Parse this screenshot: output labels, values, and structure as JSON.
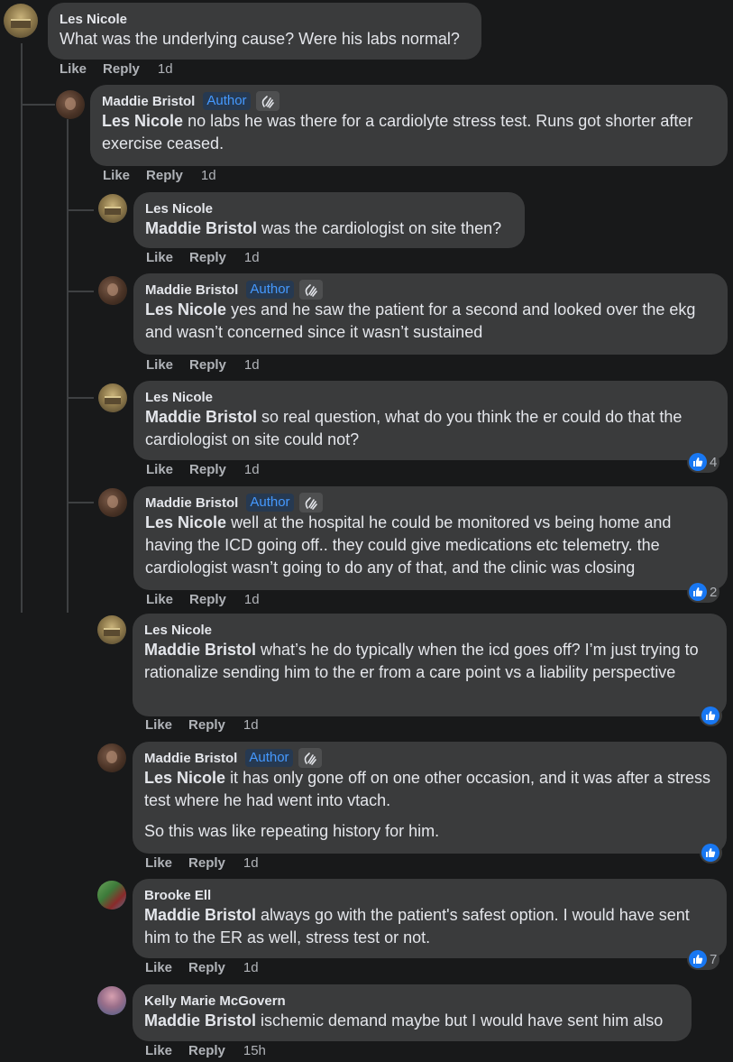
{
  "thread": {
    "labels": {
      "like": "Like",
      "reply": "Reply",
      "author_badge": "Author"
    },
    "comments": [
      {
        "name": "Les Nicole",
        "mention": "",
        "text": "What was the underlying cause? Were his labs normal?",
        "time": "1d"
      },
      {
        "name": "Maddie Bristol",
        "mention": "Les Nicole",
        "text": "no labs he was there for a cardiolyte stress test. Runs got shorter after exercise ceased.",
        "time": "1d"
      },
      {
        "name": "Les Nicole",
        "mention": "Maddie Bristol",
        "text": "was the cardiologist on site then?",
        "time": "1d"
      },
      {
        "name": "Maddie Bristol",
        "mention": "Les Nicole",
        "text": "yes and he saw the patient for a second and looked over the ekg and wasn’t concerned since it wasn’t sustained",
        "time": "1d"
      },
      {
        "name": "Les Nicole",
        "mention": "Maddie Bristol",
        "text": "so real question, what do you think the er could do that the cardiologist on site could not?",
        "time": "1d",
        "reactions": "4"
      },
      {
        "name": "Maddie Bristol",
        "mention": "Les Nicole",
        "text": "well at the hospital he could be monitored vs being home and having the ICD going off.. they could give medications etc telemetry. the cardiologist wasn’t going to do any of that, and the clinic was closing",
        "time": "1d",
        "reactions": "2"
      },
      {
        "name": "Les Nicole",
        "mention": "Maddie Bristol",
        "text": "what’s he do typically when the icd goes off? I’m just trying to rationalize sending him to the er from a care point vs a liability perspective",
        "time": "1d"
      },
      {
        "name": "Maddie Bristol",
        "mention": "Les Nicole",
        "text": "it has only gone off on one other occasion, and it was after a stress test where he had went into vtach.",
        "text2": "So this was like repeating history for him.",
        "time": "1d"
      },
      {
        "name": "Brooke Ell",
        "mention": "Maddie Bristol",
        "text": "always go with the patient's safest option. I would have sent him to the ER as well, stress test or not.",
        "time": "1d",
        "reactions": "7"
      },
      {
        "name": "Kelly Marie McGovern",
        "mention": "Maddie Bristol",
        "text": "ischemic demand maybe but I would have sent him also",
        "time": "15h"
      }
    ]
  },
  "colors": {
    "background": "#18191a",
    "bubble": "#3a3b3c",
    "text": "#e4e6eb",
    "secondary_text": "#b0b3b8",
    "author_badge_text": "#4599ff",
    "author_badge_bg": "#263951",
    "like_blue": "#1877f2"
  },
  "icons": {
    "author_badge_icon": "waving-hand-icon",
    "reaction_icon": "thumbs-up-icon"
  }
}
